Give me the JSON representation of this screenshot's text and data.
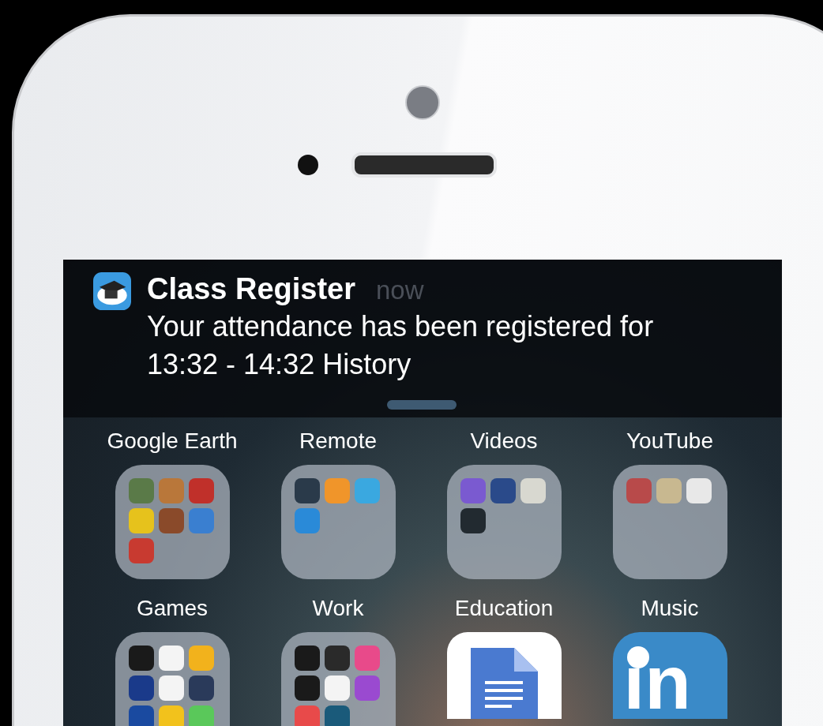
{
  "notification": {
    "app": "Class Register",
    "time": "now",
    "message": "Your attendance has been registered for 13:32 - 14:32 History"
  },
  "captions_top": [
    "Google Earth",
    "Remote",
    "Videos",
    "YouTube"
  ],
  "folders": [
    {
      "label": "Games",
      "apps": [
        {
          "color": "#5a7a48"
        },
        {
          "color": "#b9773a"
        },
        {
          "color": "#c0302a"
        },
        {
          "color": "#e6c21c"
        },
        {
          "color": "#8a4a2a"
        },
        {
          "color": "#3a7fd0"
        },
        {
          "color": "#c83a30"
        }
      ]
    },
    {
      "label": "Work",
      "apps": [
        {
          "color": "#2a3a4a"
        },
        {
          "color": "#f0952a"
        },
        {
          "color": "#3aa8e0"
        },
        {
          "color": "#2a8ad8"
        }
      ]
    },
    {
      "label": "Education",
      "apps": [
        {
          "color": "#7a5ad0"
        },
        {
          "color": "#2a4a8a"
        },
        {
          "color": "#d8d8d0"
        },
        {
          "color": "#222a30"
        }
      ]
    },
    {
      "label": "Music",
      "apps": [
        {
          "color": "#b84a4a"
        },
        {
          "color": "#c8b890"
        },
        {
          "color": "#e8e8e8"
        }
      ]
    }
  ],
  "bottom_row": [
    {
      "kind": "folder",
      "apps": [
        {
          "color": "#1a1a1a"
        },
        {
          "color": "#f4f4f4"
        },
        {
          "color": "#f2b21c"
        },
        {
          "color": "#1a3a8a"
        },
        {
          "color": "#f4f4f4"
        },
        {
          "color": "#2a3a5a"
        },
        {
          "color": "#1a4aa0"
        },
        {
          "color": "#f2c21c"
        },
        {
          "color": "#5ac85a"
        }
      ]
    },
    {
      "kind": "folder",
      "apps": [
        {
          "color": "#1a1a1a"
        },
        {
          "color": "#2a2a2a"
        },
        {
          "color": "#e84a8a"
        },
        {
          "color": "#1a1a1a"
        },
        {
          "color": "#f4f4f4"
        },
        {
          "color": "#9a4ad0"
        },
        {
          "color": "#e84a4a"
        },
        {
          "color": "#1a5a7a"
        }
      ]
    },
    {
      "kind": "docs"
    },
    {
      "kind": "linkedin",
      "text": "in"
    }
  ]
}
